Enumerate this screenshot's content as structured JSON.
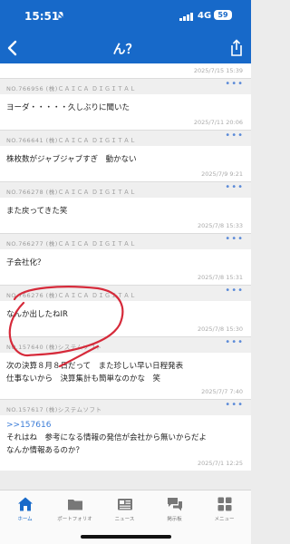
{
  "status": {
    "time": "15:51",
    "network": "4G",
    "battery": "59"
  },
  "nav": {
    "title": "ん？"
  },
  "prev_date": "2025/7/15 15:39",
  "posts": [
    {
      "no": "NO.766956 (株)ＣＡＩＣＡ ＤＩＧＩＴＡＬ",
      "body": "ヨーダ・・・・・久しぶりに聞いた",
      "date": "2025/7/11 20:06"
    },
    {
      "no": "NO.766641 (株)ＣＡＩＣＡ ＤＩＧＩＴＡＬ",
      "body": "株枚数がジャブジャブすぎ　動かない",
      "date": "2025/7/9 9:21"
    },
    {
      "no": "NO.766278 (株)ＣＡＩＣＡ ＤＩＧＩＴＡＬ",
      "body": "また戻ってきた笑",
      "date": "2025/7/8 15:33"
    },
    {
      "no": "NO.766277 (株)ＣＡＩＣＡ ＤＩＧＩＴＡＬ",
      "body": "子会社化？",
      "date": "2025/7/8 15:31"
    },
    {
      "no": "NO.766276 (株)ＣＡＩＣＡ ＤＩＧＩＴＡＬ",
      "body": "なんか出したねIR",
      "date": "2025/7/8 15:30"
    },
    {
      "no": "NO.157640 (株)システムソフト",
      "body": "次の決算８月８日だって　また珍しい早い日程発表\n仕事ないから　決算集計も簡単なのかな　笑",
      "date": "2025/7/7 7:40"
    },
    {
      "no": "NO.157617 (株)システムソフト",
      "reply": ">>157616",
      "body": "それはね　参考になる情報の発信が会社から無いからだよ\nなんか情報あるのか？",
      "date": "2025/7/1 12:25"
    }
  ],
  "more_label": "•••",
  "tabs": [
    {
      "label": "ホーム",
      "icon": "home-icon"
    },
    {
      "label": "ポートフォリオ",
      "icon": "folder-icon"
    },
    {
      "label": "ニュース",
      "icon": "newspaper-icon"
    },
    {
      "label": "掲示板",
      "icon": "chat-icon"
    },
    {
      "label": "メニュー",
      "icon": "grid-icon"
    }
  ],
  "colors": {
    "brand": "#1769c9",
    "annotation": "#d62a3a",
    "link": "#3a7cd8"
  }
}
